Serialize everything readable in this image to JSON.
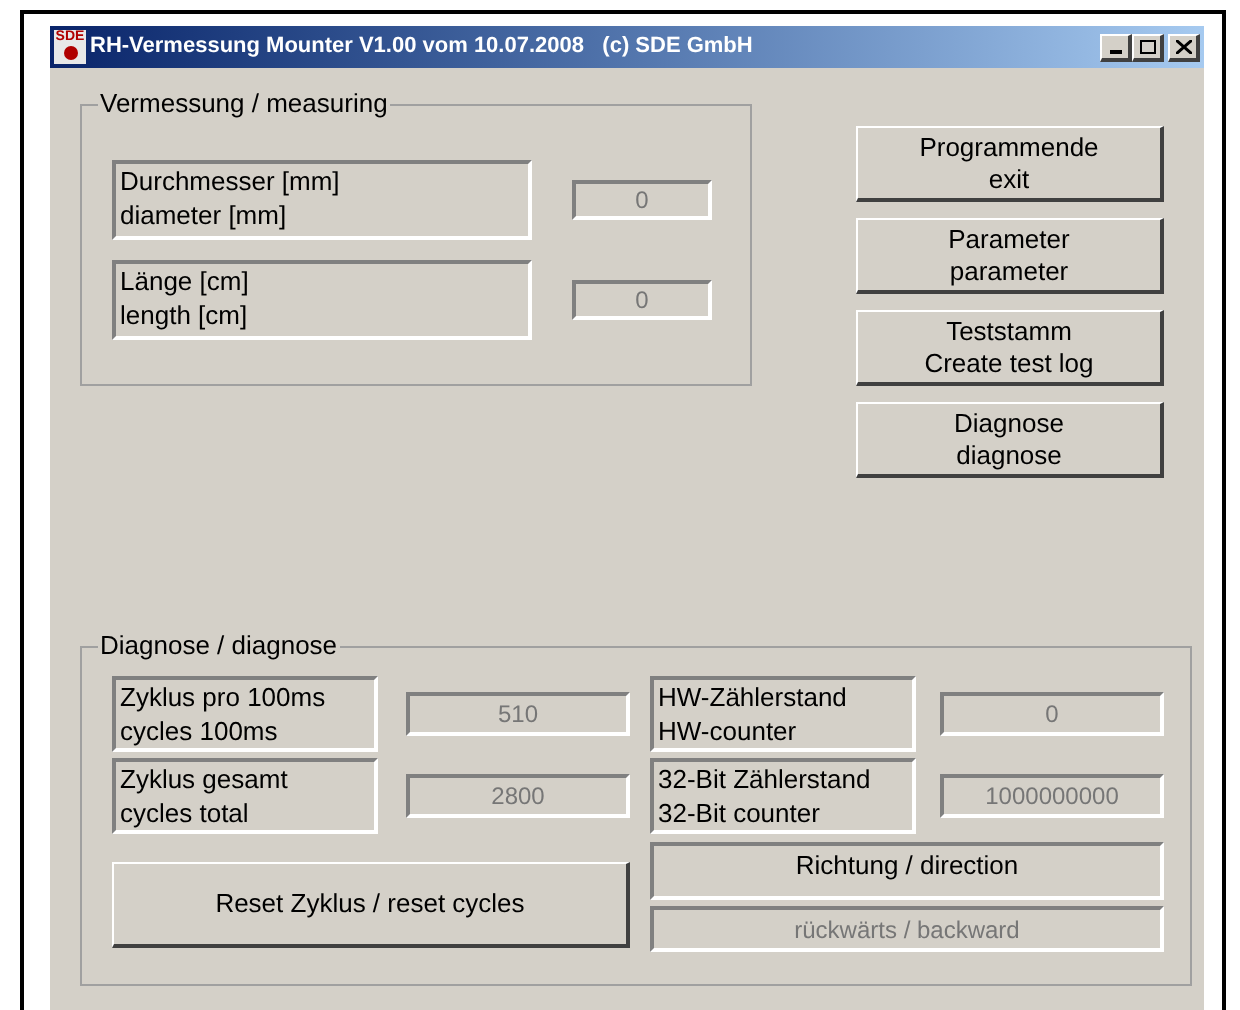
{
  "window": {
    "title": "RH-Vermessung Mounter V1.00 vom 10.07.2008   (c) SDE GmbH",
    "app_icon_text": "SDE"
  },
  "measuring": {
    "title": "Vermessung / measuring",
    "rows": [
      {
        "label": "Durchmesser [mm]\ndiameter [mm]",
        "value": "0",
        "disabled": true
      },
      {
        "label": "Länge  [cm]\nlength [cm]",
        "value": "0",
        "disabled": true
      }
    ]
  },
  "buttons": [
    {
      "label": "Programmende\nexit"
    },
    {
      "label": "Parameter\nparameter"
    },
    {
      "label": "Teststamm\nCreate test log"
    },
    {
      "label": "Diagnose\ndiagnose"
    }
  ],
  "diagnosis": {
    "title": "Diagnose / diagnose",
    "left_rows": [
      {
        "label": "Zyklus pro 100ms\ncycles 100ms",
        "value": "510",
        "disabled": true
      },
      {
        "label": "Zyklus gesamt\ncycles total",
        "value": "2800",
        "disabled": true
      }
    ],
    "right_rows": [
      {
        "label": "HW-Zählerstand\nHW-counter",
        "value": "0",
        "disabled": true
      },
      {
        "label": "32-Bit Zählerstand\n32-Bit counter",
        "value": "1000000000",
        "disabled": true
      }
    ],
    "reset_button": "Reset Zyklus / reset cycles",
    "direction_label": "Richtung / direction",
    "direction_value": {
      "value": "rückwärts / backward",
      "disabled": true
    }
  }
}
